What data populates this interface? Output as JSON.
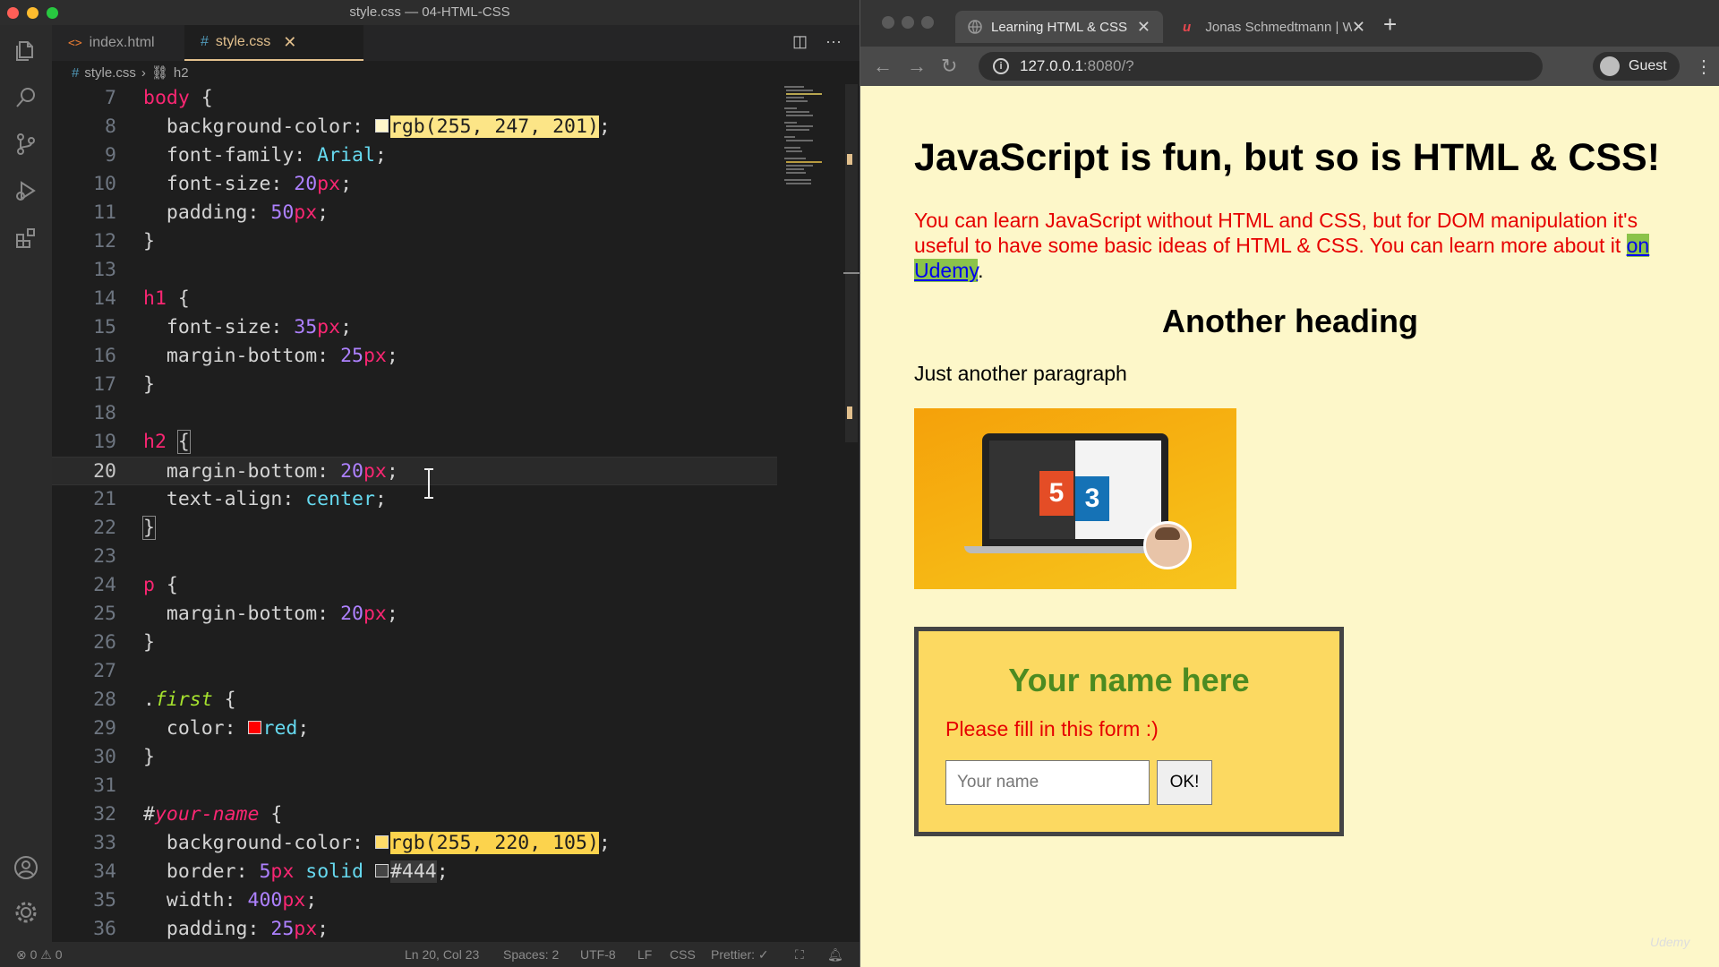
{
  "vscode": {
    "window_title": "style.css — 04-HTML-CSS",
    "tabs": [
      {
        "label": "index.html",
        "icon": "html-file-icon"
      },
      {
        "label": "style.css",
        "icon": "css-file-icon"
      }
    ],
    "breadcrumb": {
      "file": "style.css",
      "symbol": "h2"
    },
    "code_lines": [
      {
        "n": "7"
      },
      {
        "n": "8"
      },
      {
        "n": "9"
      },
      {
        "n": "10"
      },
      {
        "n": "11"
      },
      {
        "n": "12"
      },
      {
        "n": "13"
      },
      {
        "n": "14"
      },
      {
        "n": "15"
      },
      {
        "n": "16"
      },
      {
        "n": "17"
      },
      {
        "n": "18"
      },
      {
        "n": "19"
      },
      {
        "n": "20"
      },
      {
        "n": "21"
      },
      {
        "n": "22"
      },
      {
        "n": "23"
      },
      {
        "n": "24"
      },
      {
        "n": "25"
      },
      {
        "n": "26"
      },
      {
        "n": "27"
      },
      {
        "n": "28"
      },
      {
        "n": "29"
      },
      {
        "n": "30"
      },
      {
        "n": "31"
      },
      {
        "n": "32"
      },
      {
        "n": "33"
      },
      {
        "n": "34"
      },
      {
        "n": "35"
      },
      {
        "n": "36"
      }
    ],
    "code": {
      "body_sel": "body",
      "bg_prop": "background-color",
      "bg_val": "rgb(255, 247, 201)",
      "ff_prop": "font-family",
      "ff_val": "Arial",
      "fs_prop": "font-size",
      "fs_num": "20",
      "pad_prop": "padding",
      "pad_num": "50",
      "h1_sel": "h1",
      "h1_fs_num": "35",
      "mb_prop": "margin-bottom",
      "h1_mb_num": "25",
      "h2_sel": "h2",
      "h2_mb_num": "20",
      "ta_prop": "text-align",
      "ta_val": "center",
      "p_sel": "p",
      "p_mb_num": "20",
      "first_sel": "first",
      "color_prop": "color",
      "color_val": "red",
      "id_sel": "your-name",
      "yn_bg_val": "rgb(255, 220, 105)",
      "border_prop": "border",
      "border_num": "5",
      "border_style": "solid",
      "border_color": "#444",
      "width_prop": "width",
      "width_num": "400",
      "unit_px": "px",
      "yn_pad_num": "25"
    },
    "status": {
      "errors": "0",
      "warnings": "0",
      "position": "Ln 20, Col 23",
      "spaces": "Spaces: 2",
      "encoding": "UTF-8",
      "eol": "LF",
      "language": "CSS",
      "prettier": "Prettier: ✓"
    }
  },
  "browser": {
    "tabs": [
      {
        "label": "Learning HTML & CSS"
      },
      {
        "label": "Jonas Schmedtmann | Web De"
      }
    ],
    "url_host": "127.0.0.1",
    "url_rest": ":8080/?",
    "profile": "Guest",
    "page": {
      "h1": "JavaScript is fun, but so is HTML & CSS!",
      "p1_text": "You can learn JavaScript without HTML and CSS, but for DOM manipulation it's useful to have some basic ideas of HTML & CSS. You can learn more about it ",
      "p1_link": "on Udemy",
      "p1_end": ".",
      "h2": "Another heading",
      "p2": "Just another paragraph",
      "img_logo5": "5",
      "img_logo3": "3",
      "form_title": "Your name here",
      "form_text": "Please fill in this form :)",
      "input_placeholder": "Your name",
      "button_label": "OK!"
    },
    "watermark": "Udemy"
  },
  "colors": {
    "page_bg": "#fdf7c9",
    "form_bg": "#fcd961",
    "accent_red": "#e60000",
    "heading_green": "#4c8b21"
  }
}
